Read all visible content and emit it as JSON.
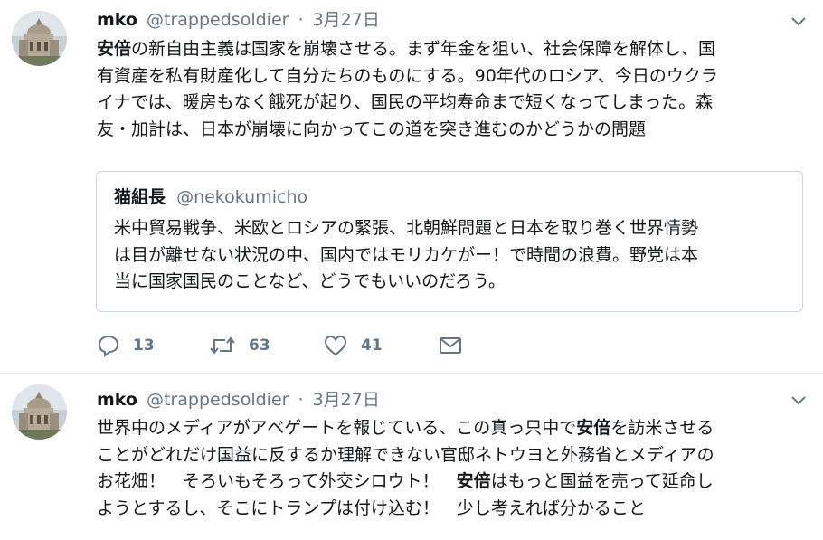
{
  "tweets": [
    {
      "name": "mko",
      "handle": "@trappedsoldier",
      "separator": "·",
      "time": "3月27日",
      "lines": [
        [
          {
            "t": "安倍",
            "b": true
          },
          {
            "t": "の新自由主義は国家を崩壊させる。まず年金を狙い、社会保障を解体し、国"
          }
        ],
        [
          {
            "t": "有資産を私有財産化して自分たちのものにする。90年代のロシア、今日のウクラ"
          }
        ],
        [
          {
            "t": "イナでは、暖房もなく餓死が起り、国民の平均寿命まで短くなってしまった。森"
          }
        ],
        [
          {
            "t": "友・加計は、日本が崩壊に向かってこの道を突き進むのかどうかの問題"
          }
        ]
      ],
      "quote": {
        "name": "猫組長",
        "handle": "@nekokumicho",
        "lines": [
          "米中貿易戦争、米欧とロシアの緊張、北朝鮮問題と日本を取り巻く世界情勢",
          "は目が離せない状況の中、国内ではモリカケがー！で時間の浪費。野党は本",
          "当に国家国民のことなど、どうでもいいのだろう。"
        ]
      },
      "actions": {
        "replies": "13",
        "retweets": "63",
        "likes": "41"
      }
    },
    {
      "name": "mko",
      "handle": "@trappedsoldier",
      "separator": "·",
      "time": "3月27日",
      "lines": [
        [
          {
            "t": "世界中のメディアがアベゲートを報じている、この真っ只中で"
          },
          {
            "t": "安倍",
            "b": true
          },
          {
            "t": "を訪米させる"
          }
        ],
        [
          {
            "t": "ことがどれだけ国益に反するか理解できない官邸ネトウヨと外務省とメディアの"
          }
        ],
        [
          {
            "t": "お花畑！　そろいもそろって外交シロウト！　"
          },
          {
            "t": "安倍",
            "b": true
          },
          {
            "t": "はもっと国益を売って延命し"
          }
        ],
        [
          {
            "t": "ようとするし、そこにトランプは付け込む！　少し考えれば分かること"
          }
        ]
      ]
    }
  ],
  "icons": {
    "caret": "chevron-down-icon",
    "reply": "reply-icon",
    "retweet": "retweet-icon",
    "like": "heart-icon",
    "dm": "envelope-icon"
  },
  "colors": {
    "text": "#14171a",
    "muted": "#657786",
    "border": "#e6ecf0"
  }
}
